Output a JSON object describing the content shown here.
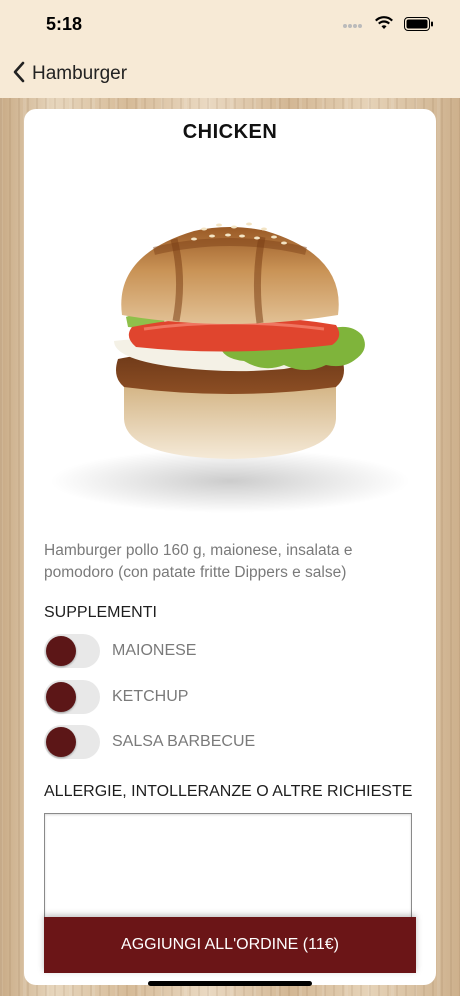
{
  "status_bar": {
    "time": "5:18",
    "signal_icon": "signal-dots-icon",
    "wifi_icon": "wifi-icon",
    "battery_icon": "battery-icon"
  },
  "nav": {
    "back_label": "Hamburger",
    "back_icon": "chevron-left-icon"
  },
  "product": {
    "title": "CHICKEN",
    "image": "chicken-burger-image",
    "description": "Hamburger pollo 160 g, maionese, insalata e pomodoro  (con patate fritte Dippers e salse)"
  },
  "supplements": {
    "title": "SUPPLEMENTI",
    "items": [
      {
        "label": "MAIONESE",
        "on": false
      },
      {
        "label": "KETCHUP",
        "on": false
      },
      {
        "label": "SALSA BARBECUE",
        "on": false
      }
    ]
  },
  "allergies": {
    "title": "ALLERGIE, INTOLLERANZE O ALTRE RICHIESTE",
    "value": ""
  },
  "add_button": {
    "label": "AGGIUNGI ALL'ORDINE (11€)"
  },
  "colors": {
    "accent": "#6b1517",
    "knob": "#5c1617",
    "header_bg": "#f7ead6"
  }
}
